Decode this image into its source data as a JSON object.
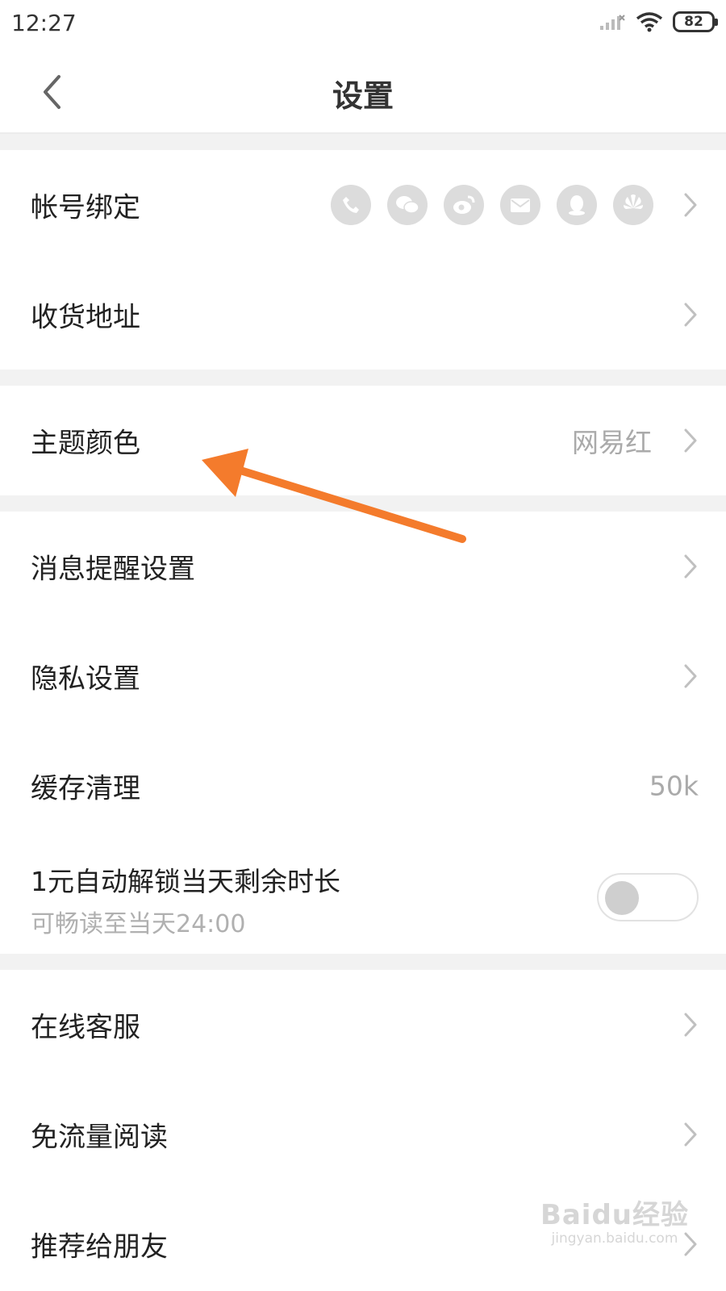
{
  "status_bar": {
    "time": "12:27",
    "battery": "82"
  },
  "nav": {
    "title": "设置"
  },
  "rows": {
    "account_binding": {
      "label": "帐号绑定"
    },
    "shipping_address": {
      "label": "收货地址"
    },
    "theme_color": {
      "label": "主题颜色",
      "value": "网易红"
    },
    "notification_settings": {
      "label": "消息提醒设置"
    },
    "privacy_settings": {
      "label": "隐私设置"
    },
    "cache_cleanup": {
      "label": "缓存清理",
      "value": "50k"
    },
    "auto_unlock": {
      "label": "1元自动解锁当天剩余时长",
      "sublabel": "可畅读至当天24:00",
      "enabled": false
    },
    "online_service": {
      "label": "在线客服"
    },
    "free_data_reading": {
      "label": "免流量阅读"
    },
    "recommend_friends": {
      "label": "推荐给朋友"
    }
  },
  "account_icons": [
    "phone-icon",
    "wechat-icon",
    "weibo-icon",
    "email-icon",
    "qq-icon",
    "huawei-icon"
  ],
  "annotation_arrow_color": "#f47b2c",
  "watermark": {
    "logo": "Baidu经验",
    "url": "jingyan.baidu.com"
  }
}
